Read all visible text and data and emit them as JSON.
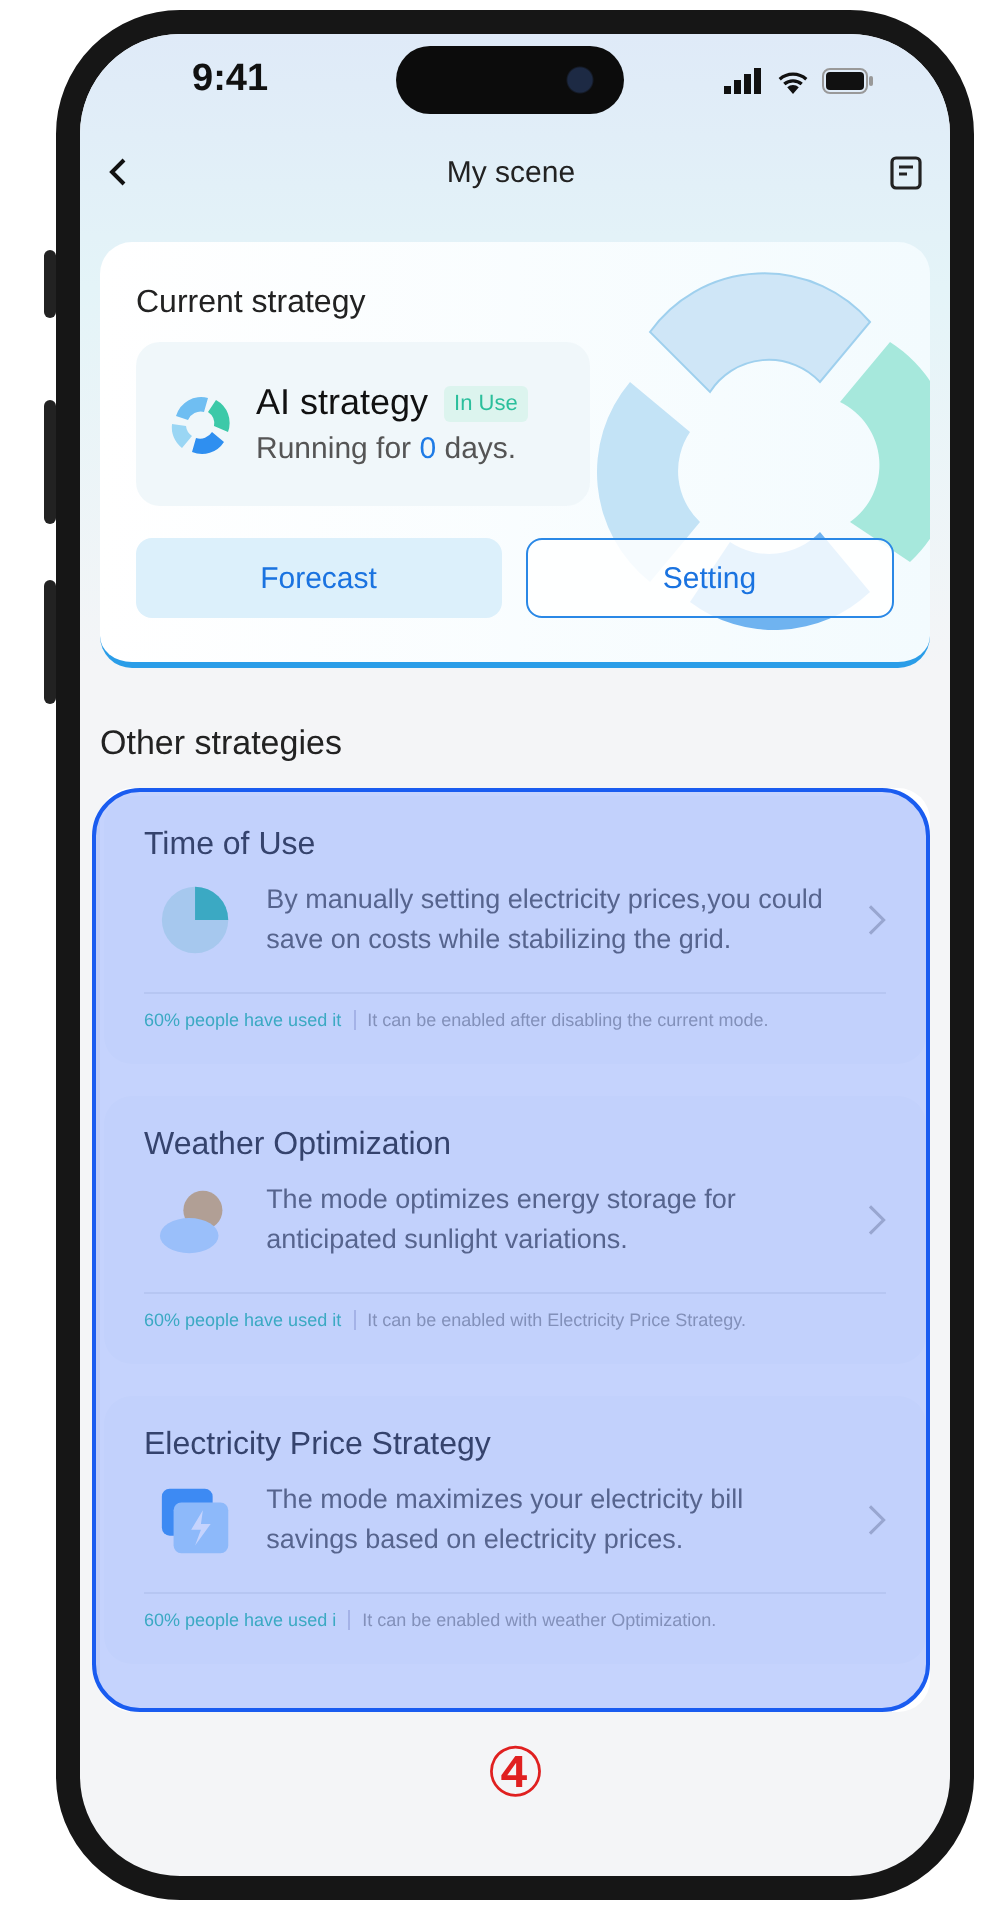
{
  "status_bar": {
    "time": "9:41"
  },
  "nav": {
    "title": "My scene"
  },
  "current": {
    "heading": "Current strategy",
    "name": "AI strategy",
    "badge": "In Use",
    "running": {
      "prefix": "Running for",
      "days": "0",
      "suffix": "days."
    },
    "buttons": [
      {
        "label": "Forecast",
        "kind": "filled"
      },
      {
        "label": "Setting",
        "kind": "outlined"
      }
    ]
  },
  "other": {
    "heading": "Other strategies",
    "items": [
      {
        "title": "Time of Use",
        "kind": "clock",
        "description": "By manually setting electricity prices,you could save on costs while stabilizing the grid.",
        "usage": "60% people have used it",
        "note": "It can be enabled after disabling the current mode."
      },
      {
        "title": "Weather Optimization",
        "kind": "weather",
        "description": "The mode optimizes energy storage for anticipated sunlight variations.",
        "usage": "60% people have used it",
        "note": "It can be enabled with Electricity Price Strategy."
      },
      {
        "title": "Electricity Price Strategy",
        "kind": "price",
        "description": "The mode maximizes your electricity bill savings based on electricity prices.",
        "usage": "60% people have used i",
        "note": "It can be enabled with weather Optimization."
      }
    ]
  },
  "annotation": {
    "label": "④"
  }
}
